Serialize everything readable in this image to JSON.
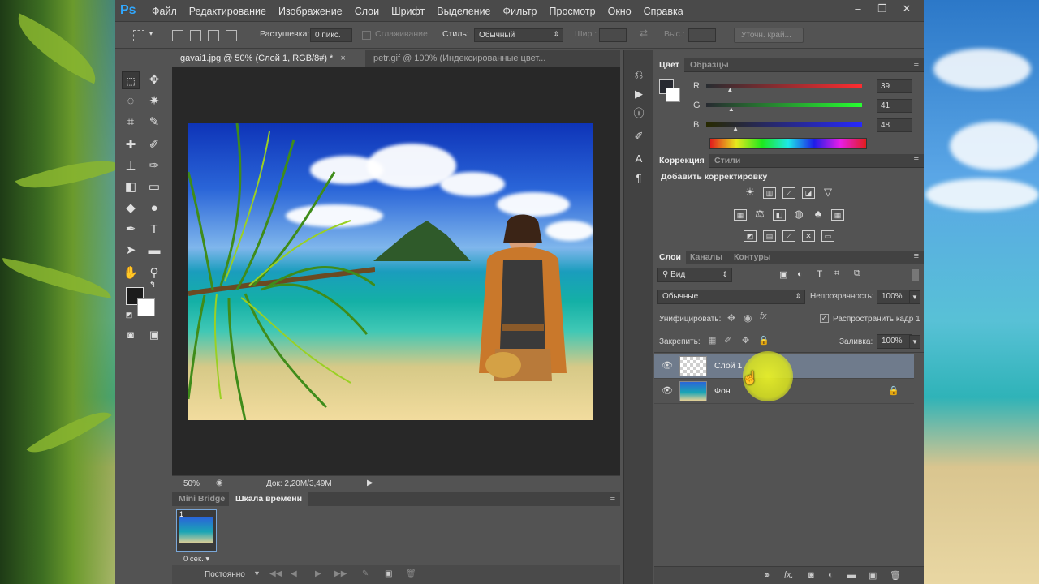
{
  "app": {
    "logo": "Ps",
    "menu": [
      "Файл",
      "Редактирование",
      "Изображение",
      "Слои",
      "Шрифт",
      "Выделение",
      "Фильтр",
      "Просмотр",
      "Окно",
      "Справка"
    ],
    "window_controls": [
      "–",
      "❐",
      "✕"
    ]
  },
  "options_bar": {
    "feather_label": "Растушевка:",
    "feather_value": "0 пикс.",
    "antialias_label": "Сглаживание",
    "style_label": "Стиль:",
    "style_value": "Обычный",
    "width_label": "Шир.:",
    "height_label": "Выс.:",
    "refine_edge": "Уточн. край..."
  },
  "documents": {
    "tabs": [
      {
        "label": "gavai1.jpg @ 50% (Слой 1, RGB/8#) *",
        "close": "×"
      },
      {
        "label": "petr.gif @ 100% (Индексированные цвет...",
        "close": ""
      }
    ]
  },
  "status": {
    "zoom": "50%",
    "doc_info": "Док: 2,20M/3,49M"
  },
  "bottom_panel": {
    "tabs": [
      "Mini Bridge",
      "Шкала времени"
    ],
    "frame_number": "1",
    "frame_delay": "0 сек. ▾",
    "loop": "Постоянно"
  },
  "color_panel": {
    "tabs": [
      "Цвет",
      "Образцы"
    ],
    "channels": [
      {
        "name": "R",
        "value": "39",
        "level": 0.153
      },
      {
        "name": "G",
        "value": "41",
        "level": 0.161
      },
      {
        "name": "B",
        "value": "48",
        "level": 0.188
      }
    ]
  },
  "adjustments_panel": {
    "tabs": [
      "Коррекция",
      "Стили"
    ],
    "title": "Добавить корректировку"
  },
  "layers_panel": {
    "tabs": [
      "Слои",
      "Каналы",
      "Контуры"
    ],
    "filter_value": "Вид",
    "blend_mode": "Обычные",
    "opacity_label": "Непрозрачность:",
    "opacity_value": "100%",
    "unify_label": "Унифицировать:",
    "propagate_label": "Распространить кадр 1",
    "lock_label": "Закрепить:",
    "fill_label": "Заливка:",
    "fill_value": "100%",
    "layers": [
      {
        "name": "Слой 1",
        "selected": true
      },
      {
        "name": "Фон",
        "selected": false
      }
    ]
  }
}
